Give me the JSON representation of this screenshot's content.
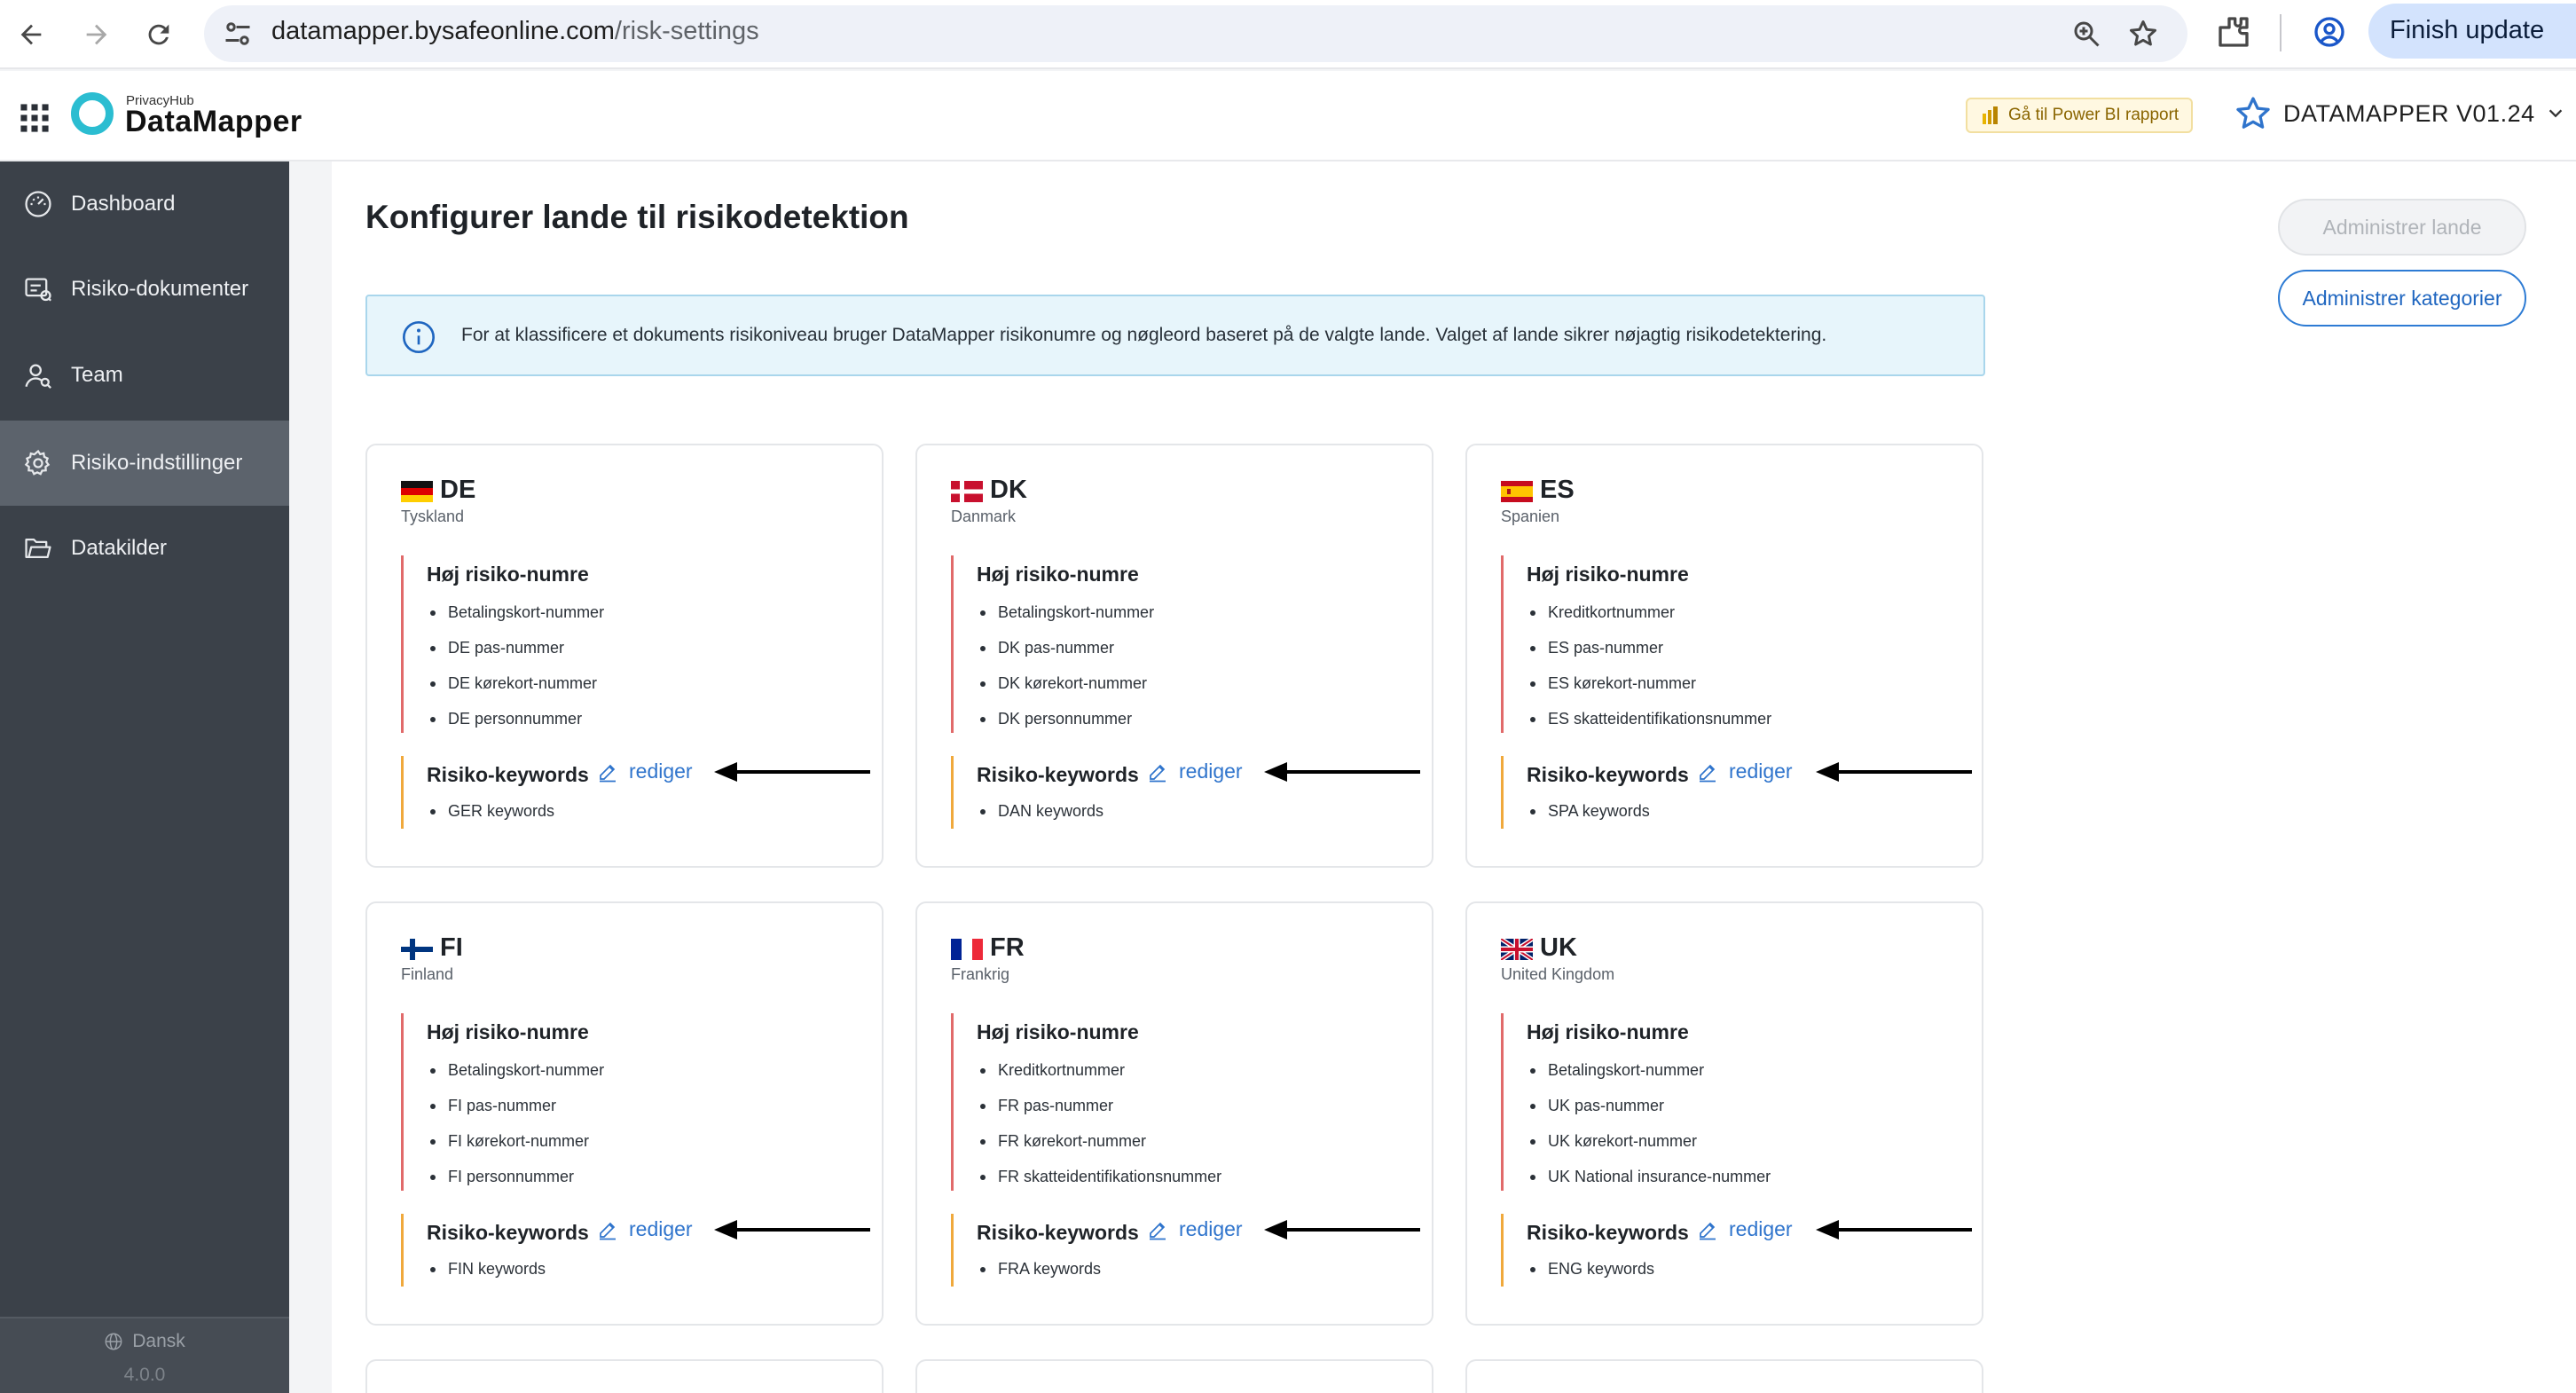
{
  "browser": {
    "url_domain": "datamapper.bysafeonline.com",
    "url_path": "/risk-settings",
    "finish_label": "Finish update"
  },
  "header": {
    "brand_small": "PrivacyHub",
    "brand_name": "DataMapper",
    "powerbi_label": "Gå til Power BI rapport",
    "project_name": "DATAMAPPER V01.24"
  },
  "sidebar": {
    "items": [
      {
        "label": "Dashboard",
        "icon": "dashboard-icon",
        "active": false
      },
      {
        "label": "Risiko-dokumenter",
        "icon": "risk-documents-icon",
        "active": false
      },
      {
        "label": "Team",
        "icon": "team-icon",
        "active": false
      },
      {
        "label": "Risiko-indstillinger",
        "icon": "gear-icon",
        "active": true
      },
      {
        "label": "Datakilder",
        "icon": "folder-icon",
        "active": false
      }
    ],
    "language": "Dansk",
    "version": "4.0.0"
  },
  "main": {
    "title": "Konfigurer lande til risikodetektion",
    "manage_countries_label": "Administrer lande",
    "manage_categories_label": "Administrer kategorier",
    "info_text": "For at klassificere et dokuments risikoniveau bruger DataMapper risikonumre og nøgleord baseret på de valgte lande. Valget af lande sikrer nøjagtig risikodetektering.",
    "high_risk_title": "Høj risiko-numre",
    "keywords_title": "Risiko-keywords",
    "edit_label": "rediger"
  },
  "countries": [
    {
      "code": "DE",
      "name": "Tyskland",
      "flag": "germany-flag-icon",
      "numbers": [
        "Betalingskort-nummer",
        "DE pas-nummer",
        "DE kørekort-nummer",
        "DE personnummer"
      ],
      "keywords": [
        "GER keywords"
      ]
    },
    {
      "code": "DK",
      "name": "Danmark",
      "flag": "denmark-flag-icon",
      "numbers": [
        "Betalingskort-nummer",
        "DK pas-nummer",
        "DK kørekort-nummer",
        "DK personnummer"
      ],
      "keywords": [
        "DAN keywords"
      ]
    },
    {
      "code": "ES",
      "name": "Spanien",
      "flag": "spain-flag-icon",
      "numbers": [
        "Kreditkortnummer",
        "ES pas-nummer",
        "ES kørekort-nummer",
        "ES skatteidentifikationsnummer"
      ],
      "keywords": [
        "SPA keywords"
      ]
    },
    {
      "code": "FI",
      "name": "Finland",
      "flag": "finland-flag-icon",
      "numbers": [
        "Betalingskort-nummer",
        "FI pas-nummer",
        "FI kørekort-nummer",
        "FI personnummer"
      ],
      "keywords": [
        "FIN keywords"
      ]
    },
    {
      "code": "FR",
      "name": "Frankrig",
      "flag": "france-flag-icon",
      "numbers": [
        "Kreditkortnummer",
        "FR pas-nummer",
        "FR kørekort-nummer",
        "FR skatteidentifikationsnummer"
      ],
      "keywords": [
        "FRA keywords"
      ]
    },
    {
      "code": "UK",
      "name": "United Kingdom",
      "flag": "uk-flag-icon",
      "numbers": [
        "Betalingskort-nummer",
        "UK pas-nummer",
        "UK kørekort-nummer",
        "UK National insurance-nummer"
      ],
      "keywords": [
        "ENG keywords"
      ]
    }
  ],
  "colors": {
    "sidebar_bg": "#3b4149",
    "sidebar_active": "#5c636c",
    "accent_blue": "#2f74cc",
    "high_risk_bar": "#e16a6a",
    "keywords_bar": "#f0a93c",
    "logo": "#2bbdd1"
  }
}
